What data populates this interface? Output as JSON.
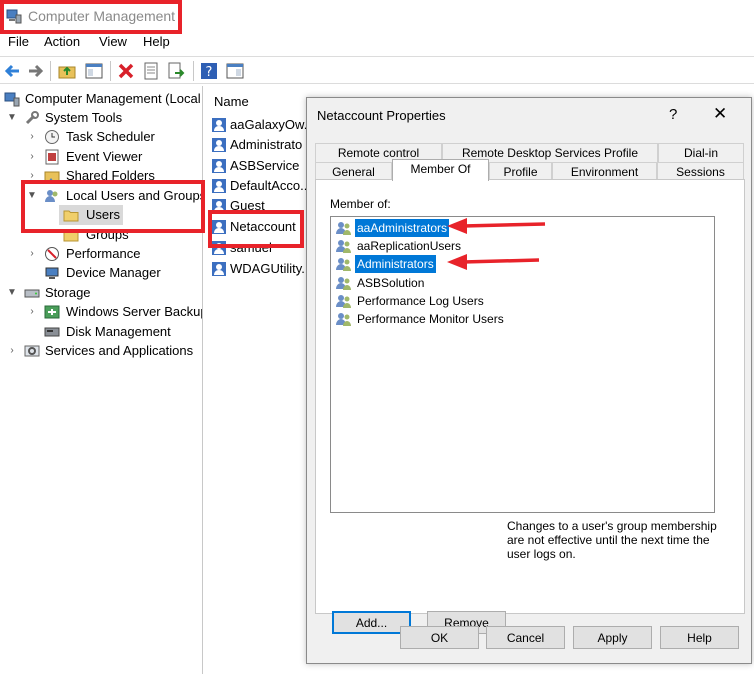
{
  "window": {
    "title": "Computer Management",
    "icon": "computer-management-icon"
  },
  "menu": [
    "File",
    "Action",
    "View",
    "Help"
  ],
  "toolbar_icons": [
    "back-arrow-icon",
    "forward-arrow-icon",
    "up-folder-icon",
    "show-hide-tree-icon",
    "delete-icon",
    "properties-icon",
    "export-list-icon",
    "help-icon",
    "action-pane-icon"
  ],
  "tree": [
    {
      "label": "Computer Management (Local",
      "icon": "computer-management-icon"
    },
    {
      "label": "System Tools",
      "icon": "tools-icon"
    },
    {
      "label": "Task Scheduler",
      "icon": "clock-icon"
    },
    {
      "label": "Event Viewer",
      "icon": "event-log-icon"
    },
    {
      "label": "Shared Folders",
      "icon": "shared-folder-icon"
    },
    {
      "label": "Local Users and Groups",
      "icon": "users-icon"
    },
    {
      "label": "Users",
      "icon": "folder-icon"
    },
    {
      "label": "Groups",
      "icon": "folder-icon"
    },
    {
      "label": "Performance",
      "icon": "performance-icon"
    },
    {
      "label": "Device Manager",
      "icon": "device-manager-icon"
    },
    {
      "label": "Storage",
      "icon": "storage-icon"
    },
    {
      "label": "Windows Server Backup",
      "icon": "backup-icon"
    },
    {
      "label": "Disk Management",
      "icon": "disk-icon"
    },
    {
      "label": "Services and Applications",
      "icon": "services-icon"
    }
  ],
  "list": {
    "header": "Name",
    "users": [
      "aaGalaxyOw...",
      "Administrato",
      "ASBService",
      "DefaultAcco...",
      "Guest",
      "Netaccount",
      "samuel",
      "WDAGUtility..."
    ]
  },
  "dialog": {
    "title": "Netaccount Properties",
    "help_glyph": "?",
    "close_glyph": "✕",
    "tabs_back": [
      "Remote control",
      "Remote Desktop Services Profile",
      "Dial-in"
    ],
    "tabs_front": [
      "General",
      "Member Of",
      "Profile",
      "Environment",
      "Sessions"
    ],
    "member_of_label": "Member of:",
    "groups": [
      "aaAdministrators",
      "aaReplicationUsers",
      "Administrators",
      "ASBSolution",
      "Performance Log Users",
      "Performance Monitor Users"
    ],
    "add_label": "Add...",
    "remove_label": "Remove",
    "note": "Changes to a user's group membership are not effective until the next time the user logs on.",
    "ok_label": "OK",
    "cancel_label": "Cancel",
    "apply_label": "Apply",
    "help_label": "Help"
  },
  "colors": {
    "highlight_box": "#e8232a",
    "selection": "#0078d7",
    "arrow": "#e8232a"
  }
}
